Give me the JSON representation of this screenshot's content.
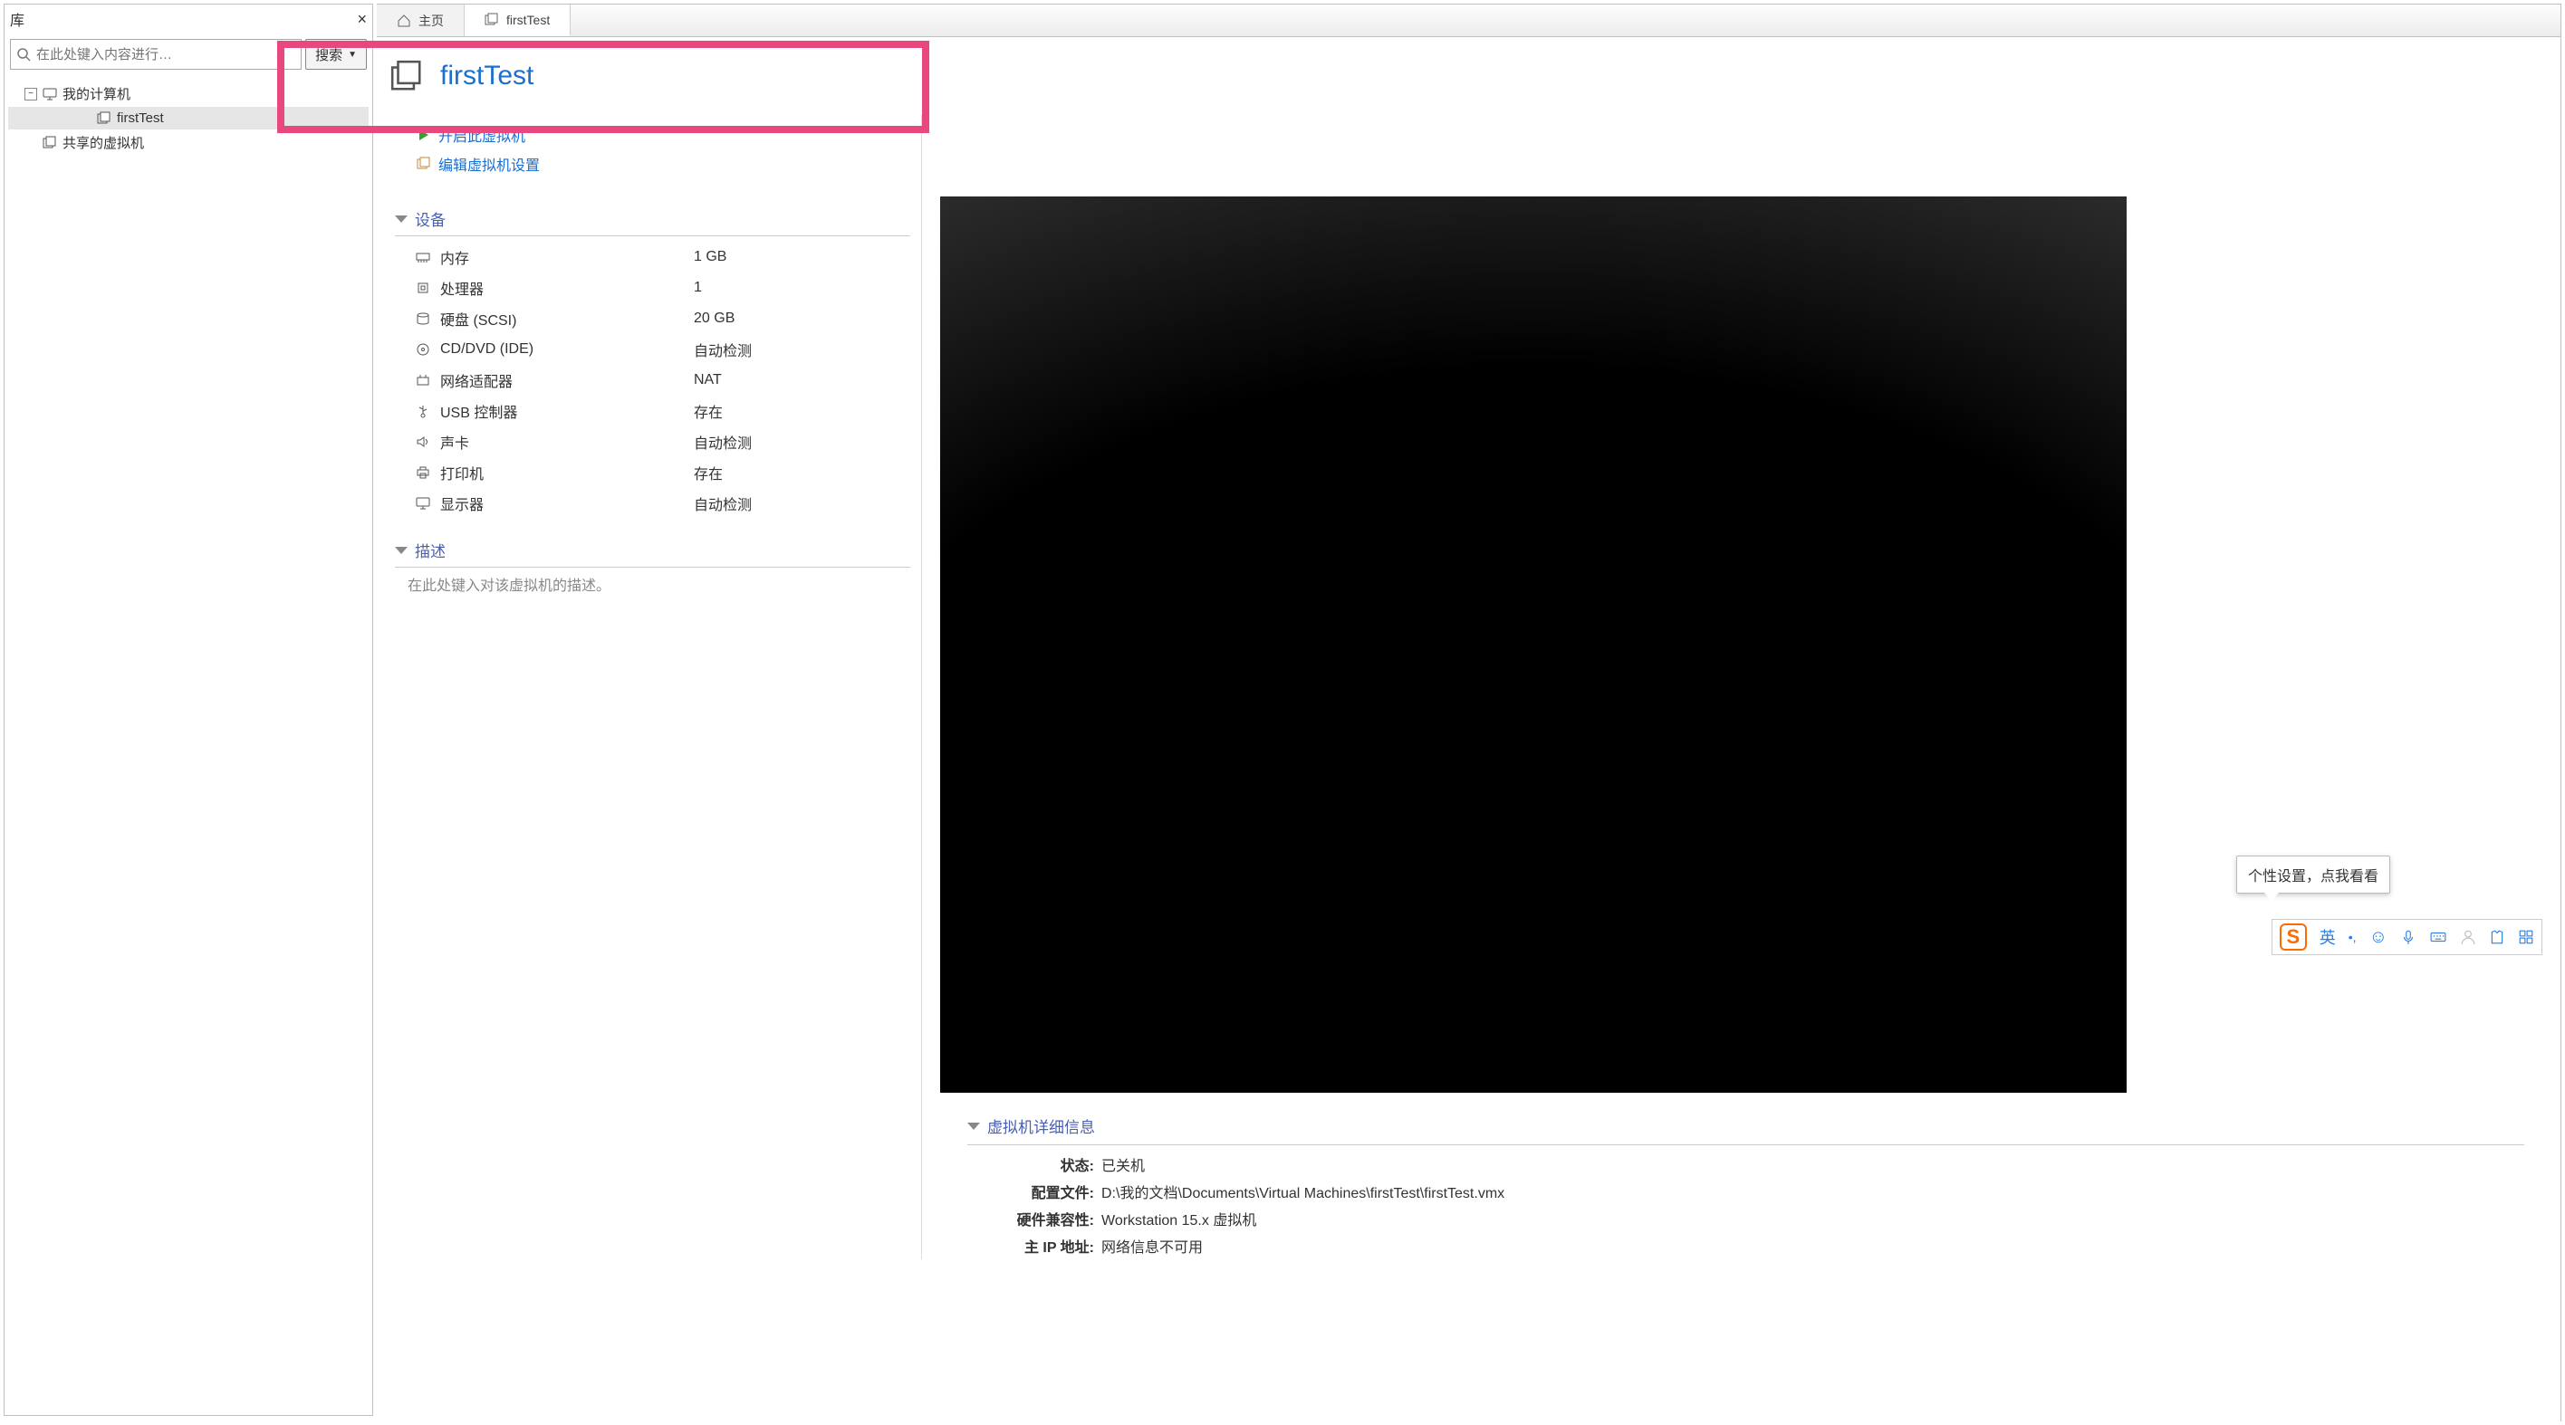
{
  "sidebar": {
    "title": "库",
    "search_placeholder": "在此处键入内容进行…",
    "search_button": "搜索",
    "tree": {
      "my_computer": "我的计算机",
      "vm1": "firstTest",
      "shared_vms": "共享的虚拟机"
    }
  },
  "tabs": {
    "home": "主页",
    "vm": "firstTest"
  },
  "vm": {
    "title": "firstTest",
    "actions": {
      "power_on": "开启此虚拟机",
      "edit_settings": "编辑虚拟机设置"
    },
    "devices_section": "设备",
    "devices": [
      {
        "icon": "memory",
        "name": "内存",
        "value": "1 GB"
      },
      {
        "icon": "cpu",
        "name": "处理器",
        "value": "1"
      },
      {
        "icon": "disk",
        "name": "硬盘 (SCSI)",
        "value": "20 GB"
      },
      {
        "icon": "disc",
        "name": "CD/DVD (IDE)",
        "value": "自动检测"
      },
      {
        "icon": "network",
        "name": "网络适配器",
        "value": "NAT"
      },
      {
        "icon": "usb",
        "name": "USB 控制器",
        "value": "存在"
      },
      {
        "icon": "sound",
        "name": "声卡",
        "value": "自动检测"
      },
      {
        "icon": "printer",
        "name": "打印机",
        "value": "存在"
      },
      {
        "icon": "display",
        "name": "显示器",
        "value": "自动检测"
      }
    ],
    "description_section": "描述",
    "description_placeholder": "在此处键入对该虚拟机的描述。",
    "details_section": "虚拟机详细信息",
    "details": {
      "state_label": "状态:",
      "state_value": "已关机",
      "config_label": "配置文件:",
      "config_value": "D:\\我的文档\\Documents\\Virtual Machines\\firstTest\\firstTest.vmx",
      "compat_label": "硬件兼容性:",
      "compat_value": "Workstation 15.x 虚拟机",
      "ip_label": "主 IP 地址:",
      "ip_value": "网络信息不可用"
    }
  },
  "ime": {
    "tooltip": "个性设置，点我看看",
    "lang": "英"
  }
}
